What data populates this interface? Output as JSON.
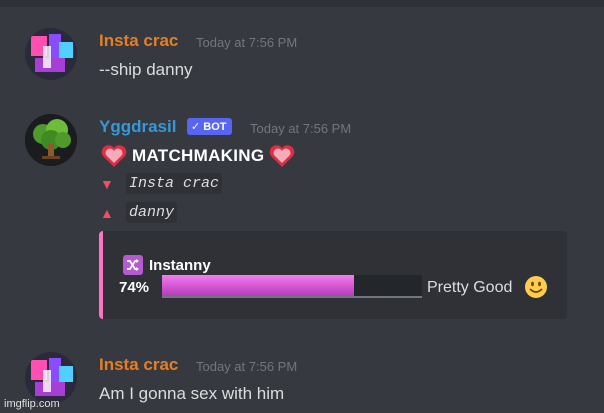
{
  "messages": [
    {
      "username": "Insta crac",
      "timestamp": "Today at 7:56 PM",
      "text": "--ship danny",
      "name_color": "#e67e22"
    },
    {
      "username": "Yggdrasil",
      "bot_badge": "✓ BOT",
      "timestamp": "Today at 7:56 PM",
      "name_color": "#3498db",
      "title": "MATCHMAKING",
      "user1": "Insta crac",
      "user2": "danny",
      "embed": {
        "ship_name": "Instanny",
        "percent_label": "74%",
        "percent": 0.74,
        "verdict": "Pretty Good",
        "accent": "#ff73c5"
      }
    },
    {
      "username": "Insta crac",
      "timestamp": "Today at 7:56 PM",
      "text": "Am I gonna sex with him",
      "name_color": "#e67e22"
    }
  ],
  "watermark": "imgflip.com",
  "icons": {
    "heart": "heart-icon",
    "down": "triangle-down-icon",
    "up": "triangle-up-icon",
    "shuffle": "shuffle-icon",
    "smile": "smile-emoji-icon",
    "tree": "tree-avatar-icon"
  }
}
